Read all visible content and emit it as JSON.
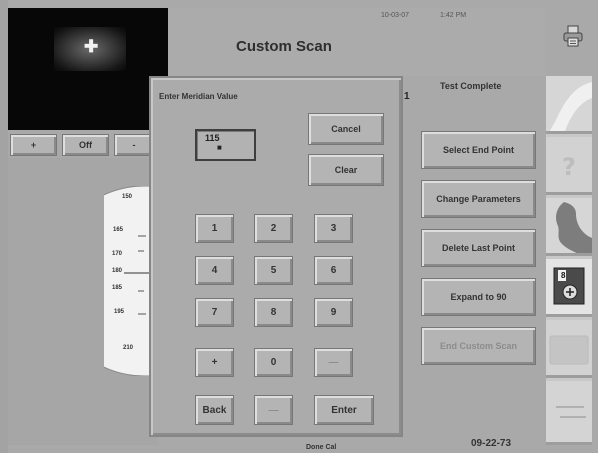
{
  "header": {
    "title": "Custom Scan",
    "date": "10-03-07",
    "time": "1:42 PM",
    "printer_icon": "printer-icon"
  },
  "status": {
    "text": "Test Complete",
    "mark": "1"
  },
  "controls": {
    "plus": "+",
    "off": "Off",
    "minus": "-"
  },
  "field": {
    "tick_labels": [
      "150",
      "165",
      "170",
      "180",
      "185",
      "195",
      "210"
    ]
  },
  "dialog": {
    "title": "Enter Meridian Value",
    "display_value": "115",
    "display_cursor": "■",
    "cancel_label": "Cancel",
    "clear_label": "Clear",
    "keys": [
      "1",
      "2",
      "3",
      "4",
      "5",
      "6",
      "7",
      "8",
      "9",
      "+",
      "0",
      "—"
    ],
    "back_label": "Back",
    "blank_label": "—",
    "enter_label": "Enter"
  },
  "actions": [
    {
      "label": "Select End Point",
      "enabled": true
    },
    {
      "label": "Change Parameters",
      "enabled": true
    },
    {
      "label": "Delete Last Point",
      "enabled": true
    },
    {
      "label": "Expand to 90",
      "enabled": true
    },
    {
      "label": "End Custom Scan",
      "enabled": false
    }
  ],
  "side_panel": {
    "icons": [
      "eye-diagram-icon",
      "help-icon",
      "head-profile-icon",
      "save-disk-icon",
      "folder-icon",
      "patient-info-icon"
    ],
    "save_number": "8"
  },
  "footer": {
    "left_text": "Done Cal",
    "right_text": "09-22-73"
  }
}
